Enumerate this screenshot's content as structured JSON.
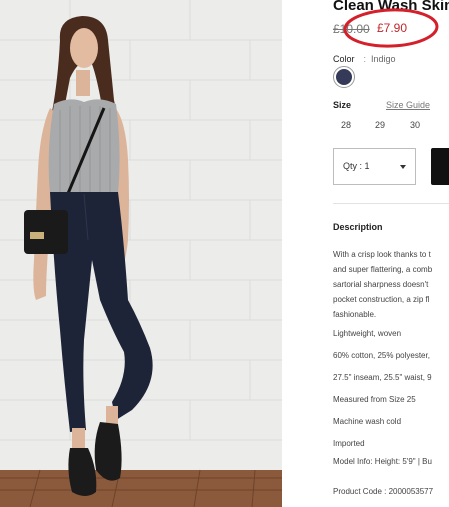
{
  "product": {
    "title": "Clean Wash Skin",
    "old_price": "£10.00",
    "price": "£7.90",
    "annotation_color": "#d3202b"
  },
  "color": {
    "label": "Color",
    "separator": ":",
    "value": "Indigo",
    "swatch_color": "#343a57"
  },
  "size": {
    "label": "Size",
    "guide_label": "Size Guide",
    "options": [
      "28",
      "29",
      "30"
    ]
  },
  "quantity": {
    "label": "Qty : 1"
  },
  "description": {
    "heading": "Description",
    "paragraph": [
      "With a crisp look thanks to t",
      "and super flattering, a comb",
      "sartorial sharpness doesn't",
      "pocket construction, a zip fl",
      "fashionable."
    ],
    "details": [
      "Lightweight, woven",
      "60% cotton, 25% polyester,",
      "27.5\" inseam, 25.5\" waist, 9",
      "Measured from Size 25",
      "Machine wash cold",
      "Imported",
      "Model Info: Height: 5'9\" | Bu"
    ],
    "product_code": "Product Code : 2000053577"
  }
}
